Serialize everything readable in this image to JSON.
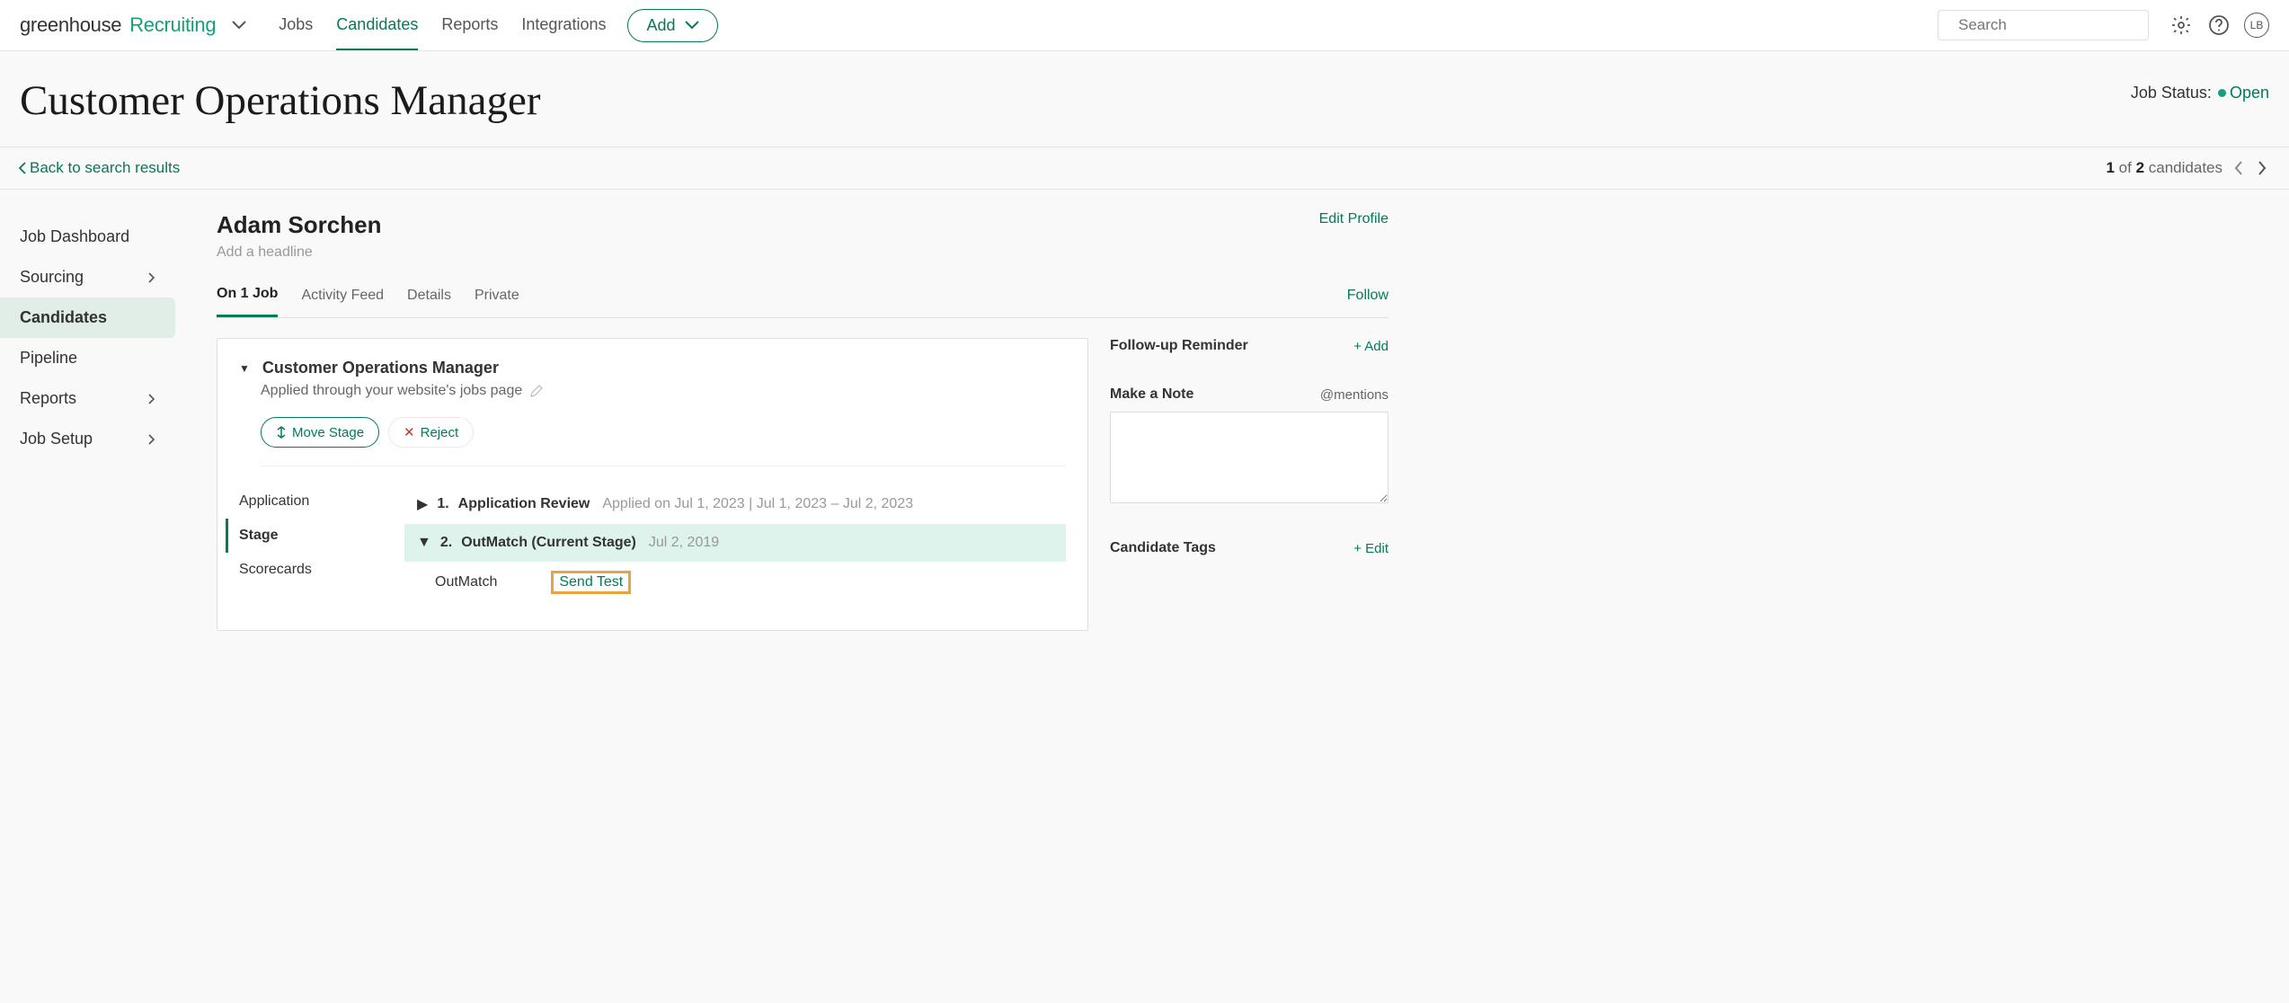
{
  "topnav": {
    "items": [
      "Jobs",
      "Candidates",
      "Reports",
      "Integrations"
    ],
    "active": 1
  },
  "add_label": "Add",
  "search_placeholder": "Search",
  "avatar_initials": "LB",
  "page_title": "Customer Operations Manager",
  "job_status_label": "Job Status:",
  "job_status_value": "Open",
  "back_link": "Back to search results",
  "pager": {
    "current": "1",
    "of": "of",
    "total": "2",
    "suffix": "candidates"
  },
  "sidebar": {
    "items": [
      "Job Dashboard",
      "Sourcing",
      "Candidates",
      "Pipeline",
      "Reports",
      "Job Setup"
    ],
    "has_chevron": [
      false,
      true,
      false,
      false,
      true,
      true
    ],
    "active": 2
  },
  "candidate": {
    "name": "Adam Sorchen",
    "headline_placeholder": "Add a headline",
    "edit_profile": "Edit Profile",
    "follow": "Follow"
  },
  "tabs": {
    "items": [
      "On 1 Job",
      "Activity Feed",
      "Details",
      "Private"
    ],
    "active": 0
  },
  "card": {
    "job_name": "Customer Operations Manager",
    "applied_via": "Applied through your website's jobs page",
    "move_stage": "Move Stage",
    "reject": "Reject",
    "stage_left": [
      "Application",
      "Stage",
      "Scorecards"
    ],
    "stage_left_active": 1,
    "stages": [
      {
        "num": "1.",
        "label": "Application Review",
        "meta": "Applied on Jul 1, 2023 | Jul 1, 2023 – Jul 2, 2023",
        "current": false
      },
      {
        "num": "2.",
        "label": "OutMatch (Current Stage)",
        "meta": "Jul 2, 2019",
        "current": true
      }
    ],
    "detail_name": "OutMatch",
    "send_test": "Send Test"
  },
  "right_rail": {
    "followup": {
      "title": "Follow-up Reminder",
      "action": "+ Add"
    },
    "note": {
      "title": "Make a Note",
      "action": "@mentions"
    },
    "tags": {
      "title": "Candidate Tags",
      "action": "+ Edit"
    }
  }
}
